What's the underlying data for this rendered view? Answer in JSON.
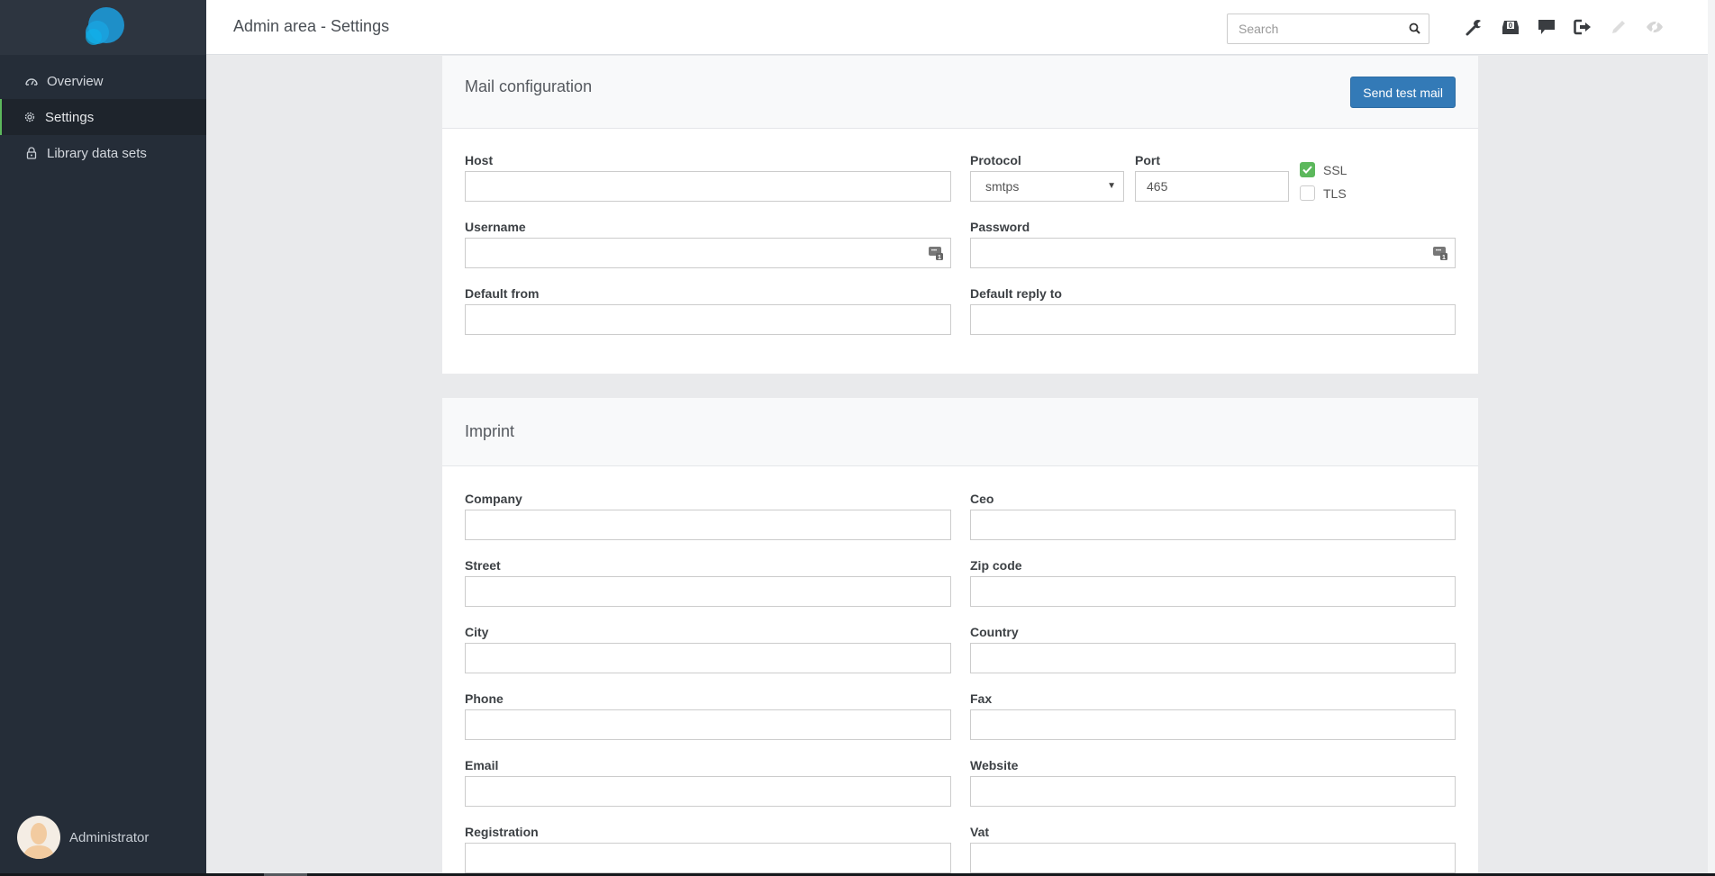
{
  "app": {
    "title": "Admin area - Settings",
    "brand_color": "#1e9bd7",
    "accent_color": "#337ab7",
    "active_indicator_color": "#5cb85c"
  },
  "sidebar": {
    "items": [
      {
        "label": "Overview",
        "icon": "dashboard-icon",
        "active": false
      },
      {
        "label": "Settings",
        "icon": "gear-icon",
        "active": true
      },
      {
        "label": "Library data sets",
        "icon": "lock-icon",
        "active": false
      }
    ],
    "user": {
      "name": "Administrator",
      "icon": "avatar"
    }
  },
  "header": {
    "search": {
      "placeholder": "Search",
      "value": ""
    },
    "icons": [
      {
        "name": "wrench-icon",
        "enabled": true
      },
      {
        "name": "inbox-icon",
        "badge": "0",
        "enabled": true
      },
      {
        "name": "comment-icon",
        "enabled": true
      },
      {
        "name": "logout-icon",
        "enabled": true
      },
      {
        "name": "pencil-icon",
        "enabled": false
      },
      {
        "name": "eye-slash-icon",
        "enabled": false
      }
    ]
  },
  "mail": {
    "title": "Mail configuration",
    "send_test_label": "Send test mail",
    "host": {
      "label": "Host",
      "value": ""
    },
    "protocol": {
      "label": "Protocol",
      "value": "smtps"
    },
    "port": {
      "label": "Port",
      "value": "465"
    },
    "ssl": {
      "label": "SSL",
      "checked": true
    },
    "tls": {
      "label": "TLS",
      "checked": false
    },
    "username": {
      "label": "Username",
      "value": ""
    },
    "password": {
      "label": "Password",
      "value": ""
    },
    "default_from": {
      "label": "Default from",
      "value": ""
    },
    "default_reply_to": {
      "label": "Default reply to",
      "value": ""
    }
  },
  "imprint": {
    "title": "Imprint",
    "fields": [
      {
        "label": "Company",
        "value": ""
      },
      {
        "label": "Ceo",
        "value": ""
      },
      {
        "label": "Street",
        "value": ""
      },
      {
        "label": "Zip code",
        "value": ""
      },
      {
        "label": "City",
        "value": ""
      },
      {
        "label": "Country",
        "value": ""
      },
      {
        "label": "Phone",
        "value": ""
      },
      {
        "label": "Fax",
        "value": ""
      },
      {
        "label": "Email",
        "value": ""
      },
      {
        "label": "Website",
        "value": ""
      },
      {
        "label": "Registration",
        "value": ""
      },
      {
        "label": "Vat",
        "value": ""
      }
    ]
  }
}
